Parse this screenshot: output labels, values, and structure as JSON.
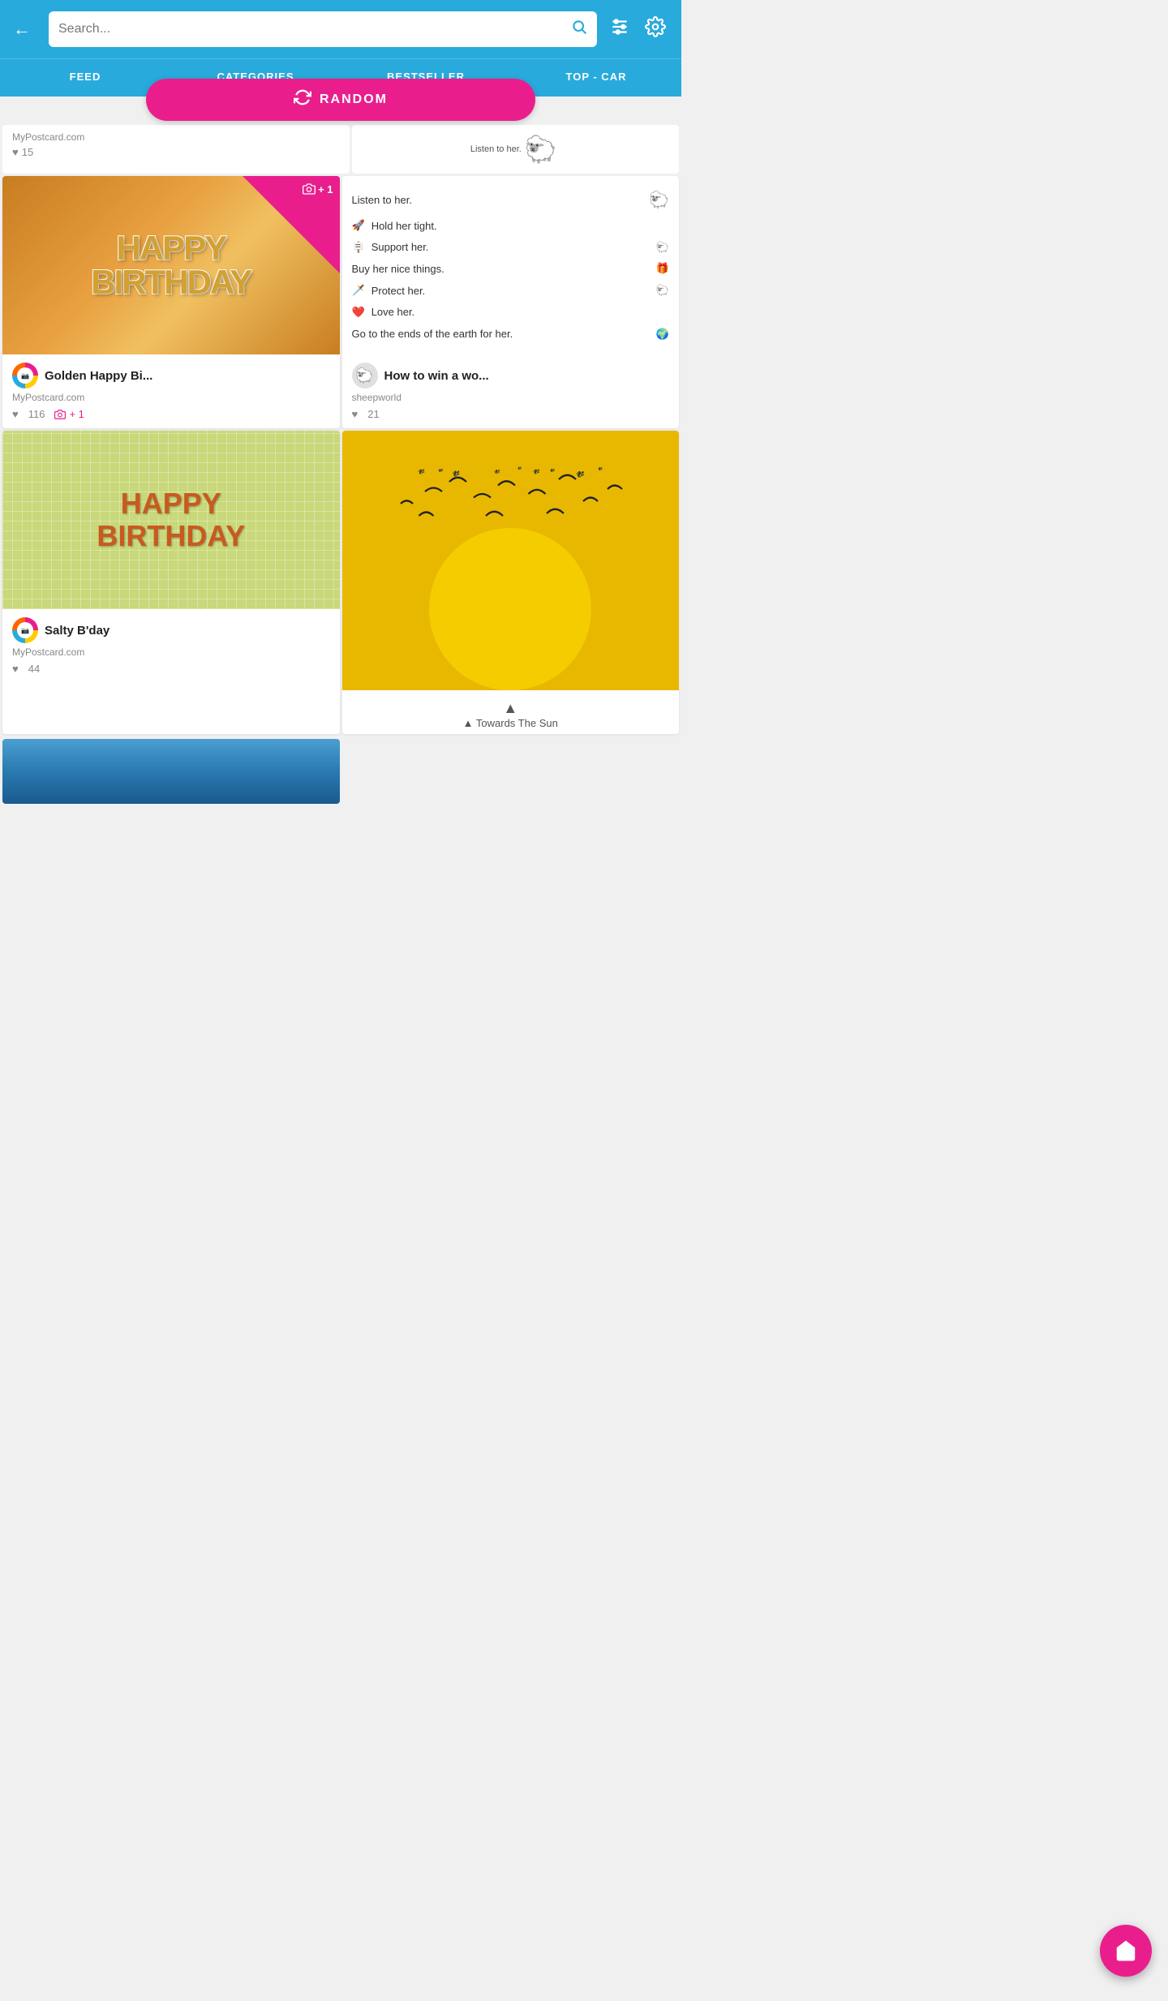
{
  "header": {
    "search_placeholder": "Search...",
    "back_label": "←"
  },
  "nav": {
    "tabs": [
      {
        "id": "feed",
        "label": "FEED",
        "active": false
      },
      {
        "id": "categories",
        "label": "CATEGORIES",
        "active": true
      },
      {
        "id": "bestseller",
        "label": "BESTSELLER",
        "active": false
      },
      {
        "id": "top-car",
        "label": "TOP - CAR",
        "active": false
      }
    ]
  },
  "random_button": {
    "label": "RANDOM"
  },
  "partial_top_left": {
    "source": "MyPostcard.com",
    "likes": "15"
  },
  "cards": [
    {
      "id": "golden-happy-birthday",
      "title": "Golden Happy Bi...",
      "source": "MyPostcard.com",
      "likes": "116",
      "camera_count": "+ 1",
      "type": "birthday-gold"
    },
    {
      "id": "how-to-win-a-woman",
      "title": "How to win a wo...",
      "source": "sheepworld",
      "likes": "21",
      "type": "sheep"
    },
    {
      "id": "salty-bday",
      "title": "Salty B'day",
      "source": "MyPostcard.com",
      "likes": "44",
      "type": "pretzel"
    },
    {
      "id": "towards-the-sun",
      "title": "Towards The Sun...",
      "source": "",
      "likes": "",
      "type": "yellow-birds"
    }
  ],
  "partial_bottom_left": {
    "type": "blue",
    "arrow_label": "▲ Towards The Sun"
  },
  "sheep_lines": [
    "Listen to her.",
    "Hold her tight.",
    "Support her.",
    "Buy her nice things.",
    "Protect her.",
    "Love her.",
    "Go to the ends of the earth for her."
  ],
  "fab": {
    "label": "⌂"
  }
}
